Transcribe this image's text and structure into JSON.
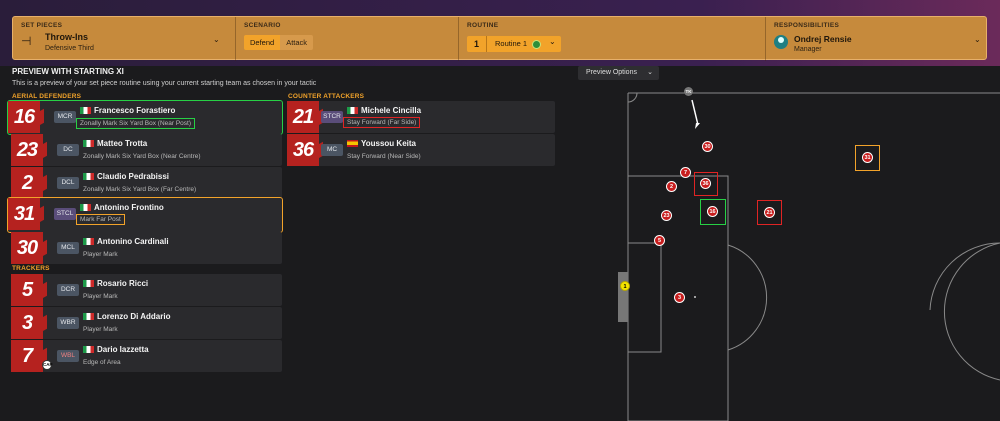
{
  "header": {
    "set_pieces": {
      "label": "SET PIECES",
      "title": "Throw-Ins",
      "subtitle": "Defensive Third"
    },
    "scenario": {
      "label": "SCENARIO",
      "options": [
        "Defend",
        "Attack"
      ],
      "selected": "Defend"
    },
    "routine": {
      "label": "ROUTINE",
      "number": "1",
      "name": "Routine 1"
    },
    "responsibilities": {
      "label": "RESPONSIBILITIES",
      "name": "Ondrej Rensie",
      "role": "Manager"
    }
  },
  "preview": {
    "title": "PREVIEW WITH STARTING XI",
    "description": "This is a preview of your set piece routine using your current starting team as chosen in your tactic",
    "options_label": "Preview Options"
  },
  "sections": {
    "aerial": "AERIAL DEFENDERS",
    "trackers": "TRACKERS",
    "counter": "COUNTER ATTACKERS"
  },
  "aerial_defenders": [
    {
      "number": "16",
      "position": "MCR",
      "name": "Francesco Forastiero",
      "role": "Zonally Mark Six Yard Box (Near Post)",
      "flag": "it"
    },
    {
      "number": "23",
      "position": "DC",
      "name": "Matteo Trotta",
      "role": "Zonally Mark Six Yard Box (Near Centre)",
      "flag": "it"
    },
    {
      "number": "2",
      "position": "DCL",
      "name": "Claudio Pedrabissi",
      "role": "Zonally Mark Six Yard Box (Far Centre)",
      "flag": "it"
    },
    {
      "number": "31",
      "position": "STCL",
      "name": "Antonino Frontino",
      "role": "Mark Far Post",
      "flag": "it"
    },
    {
      "number": "30",
      "position": "MCL",
      "name": "Antonino Cardinali",
      "role": "Player Mark",
      "flag": "it"
    }
  ],
  "trackers": [
    {
      "number": "5",
      "position": "DCR",
      "name": "Rosario Ricci",
      "role": "Player Mark",
      "flag": "it"
    },
    {
      "number": "3",
      "position": "WBR",
      "name": "Lorenzo Di Addario",
      "role": "Player Mark",
      "flag": "it"
    },
    {
      "number": "7",
      "position": "WBL",
      "name": "Dario Iazzetta",
      "role": "Edge of Area",
      "flag": "it",
      "captain": "CAP"
    }
  ],
  "counter_attackers": [
    {
      "number": "21",
      "position": "STCR",
      "name": "Michele Cincilla",
      "role": "Stay Forward (Far Side)",
      "flag": "it"
    },
    {
      "number": "36",
      "position": "MC",
      "name": "Youssou Keita",
      "role": "Stay Forward (Near Side)",
      "flag": "es"
    }
  ],
  "pitch": {
    "taker_label": "TK",
    "ball_label": "1",
    "players": [
      "30",
      "7",
      "2",
      "36",
      "16",
      "23",
      "21",
      "5",
      "3",
      "31"
    ]
  },
  "colors": {
    "accent": "#f2a32a",
    "jersey": "#b5221f",
    "highlight_green": "#27d045",
    "highlight_red": "#e02424"
  }
}
